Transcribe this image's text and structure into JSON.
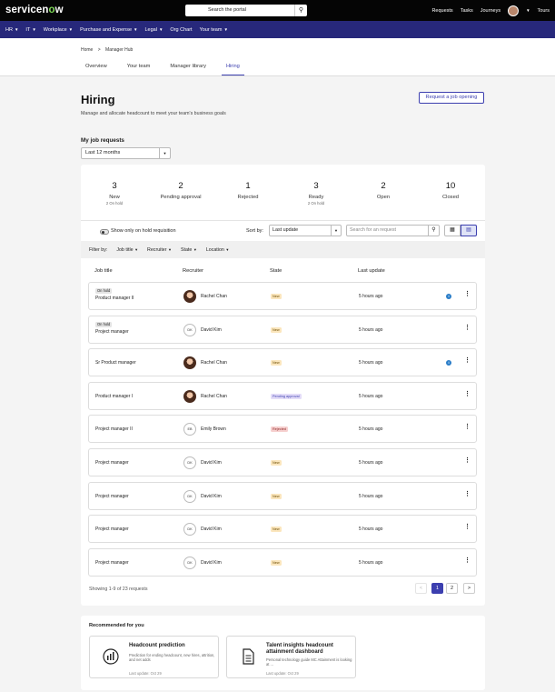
{
  "brand": {
    "logo_main": "servicen",
    "logo_o": "o",
    "logo_end": "w"
  },
  "search": {
    "label": "Search the portal"
  },
  "top_links": {
    "requests": "Requests",
    "tasks": "Tasks",
    "journeys": "Journeys",
    "tours": "Tours"
  },
  "nav": [
    {
      "label": "HR",
      "caret": "▼"
    },
    {
      "label": "IT",
      "caret": "▼"
    },
    {
      "label": "Workplace",
      "caret": "▼"
    },
    {
      "label": "Purchase and Expense",
      "caret": "▼"
    },
    {
      "label": "Legal",
      "caret": "▼"
    },
    {
      "label": "Org Chart",
      "caret": ""
    },
    {
      "label": "Your team",
      "caret": "▼"
    }
  ],
  "breadcrumb": {
    "home": "Home",
    "sep": ">",
    "current": "Manager Hub"
  },
  "tabs": [
    "Overview",
    "Your team",
    "Manager library",
    "Hiring"
  ],
  "page": {
    "title": "Hiring",
    "subtitle": "Manage and allocate headcount to meet your team's business goals",
    "request_button": "Request a job opening",
    "section_title": "My job requests",
    "period": "Last 12 months"
  },
  "stats": [
    {
      "value": "3",
      "label": "New",
      "sub": "2 On hold"
    },
    {
      "value": "2",
      "label": "Pending approval",
      "sub": ""
    },
    {
      "value": "1",
      "label": "Rejected",
      "sub": ""
    },
    {
      "value": "3",
      "label": "Ready",
      "sub": "2 On hold"
    },
    {
      "value": "2",
      "label": "Open",
      "sub": ""
    },
    {
      "value": "10",
      "label": "Closed",
      "sub": ""
    }
  ],
  "toolbar": {
    "toggle_label": "Show only on hold requisition",
    "sort_label": "Sort by:",
    "sort_value": "Last update",
    "search_placeholder": "Search for an request"
  },
  "filters": {
    "label": "Filter by:",
    "items": [
      "Job title",
      "Recruiter",
      "State",
      "Location"
    ]
  },
  "columns": {
    "job": "Job title",
    "recruiter": "Recruiter",
    "state": "State",
    "update": "Last update"
  },
  "rows": [
    {
      "hold": "On hold",
      "job": "Product manager II",
      "avatar": "photo",
      "initials": "",
      "recruiter": "Rachel Chan",
      "state": "New",
      "state_type": "new",
      "updated": "5 hours ago",
      "info": true
    },
    {
      "hold": "On hold",
      "job": "Project manager",
      "avatar": "init",
      "initials": "DK",
      "recruiter": "David Kim",
      "state": "New",
      "state_type": "new",
      "updated": "5 hours ago",
      "info": false
    },
    {
      "hold": "",
      "job": "Sr Product manager",
      "avatar": "photo",
      "initials": "",
      "recruiter": "Rachel Chan",
      "state": "New",
      "state_type": "new",
      "updated": "5 hours ago",
      "info": true
    },
    {
      "hold": "",
      "job": "Product manager I",
      "avatar": "photo",
      "initials": "",
      "recruiter": "Rachel Chan",
      "state": "Pending approval",
      "state_type": "pend",
      "updated": "5 hours ago",
      "info": false
    },
    {
      "hold": "",
      "job": "Project manager II",
      "avatar": "init",
      "initials": "EB",
      "recruiter": "Emily Brown",
      "state": "Rejected",
      "state_type": "rej",
      "updated": "5 hours ago",
      "info": false
    },
    {
      "hold": "",
      "job": "Project manager",
      "avatar": "init",
      "initials": "DK",
      "recruiter": "David Kim",
      "state": "New",
      "state_type": "new",
      "updated": "5 hours ago",
      "info": false
    },
    {
      "hold": "",
      "job": "Project manager",
      "avatar": "init",
      "initials": "DK",
      "recruiter": "David Kim",
      "state": "New",
      "state_type": "new",
      "updated": "5 hours ago",
      "info": false
    },
    {
      "hold": "",
      "job": "Project manager",
      "avatar": "init",
      "initials": "DK",
      "recruiter": "David Kim",
      "state": "New",
      "state_type": "new",
      "updated": "5 hours ago",
      "info": false
    },
    {
      "hold": "",
      "job": "Project manager",
      "avatar": "init",
      "initials": "DK",
      "recruiter": "David Kim",
      "state": "New",
      "state_type": "new",
      "updated": "5 hours ago",
      "info": false
    }
  ],
  "pagination": {
    "showing": "Showing 1-9 of 23 requests",
    "prev": "<",
    "pages": [
      "1",
      "2"
    ],
    "next": ">",
    "current": "1"
  },
  "recommended": {
    "title": "Recommended for you",
    "cards": [
      {
        "icon": "chart-icon",
        "title": "Headcount prediction",
        "desc": "Prediction for ending headcount, new hires, attrition, and net adds",
        "updated": "Last update: Oct 29"
      },
      {
        "icon": "document-icon",
        "title": "Talent insights headcount attainment dashboard",
        "desc": "Personal technology guide MC Attainment is looking at ...",
        "updated": "Last update: Oct 29"
      }
    ]
  },
  "colors": {
    "nav_bg": "#27287b",
    "accent": "#3c3faf",
    "topbar_bg": "#050505",
    "logo_o": "#7ed957"
  }
}
